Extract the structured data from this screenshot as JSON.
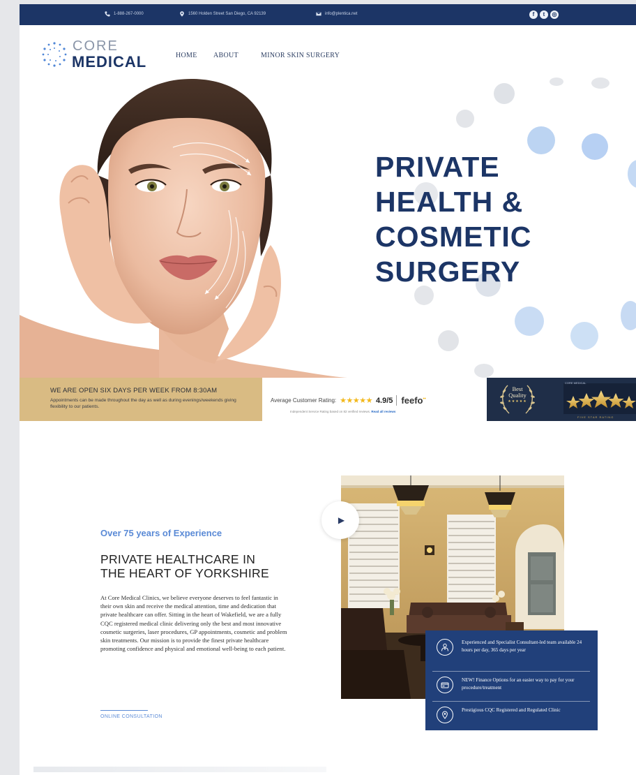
{
  "topbar": {
    "phone": "1-888-267-0000",
    "address": "1560 Holden Street San Diego, CA 92139",
    "email": "info@plentica.net",
    "social_icons": [
      "facebook-icon",
      "twitter-icon",
      "instagram-icon"
    ]
  },
  "brand": {
    "line1": "CORE",
    "line2": "MEDICAL"
  },
  "nav": {
    "home": "HOME",
    "about": "ABOUT",
    "minor": "MINOR SKIN SURGERY"
  },
  "hero": {
    "line1": "PRIVATE",
    "line2": "HEALTH &",
    "line3": "COSMETIC",
    "line4": "SURGERY"
  },
  "open": {
    "title": "WE ARE OPEN SIX DAYS PER WEEK FROM 8:30AM",
    "text": "Appointments can be made throughout the day as well as during evenings/weekends giving flexibility to our patients."
  },
  "rating": {
    "label": "Average Customer Rating:",
    "stars": "★★★★★",
    "score": "4.9/5",
    "brand": "feefo",
    "sub": "Independent Service Rating based on 82 verified reviews.",
    "link": "Read all reviews"
  },
  "badges": {
    "best_line1": "Best",
    "best_line2": "Quality",
    "best_stars": "★★★★★",
    "core": "CORE MEDICAL",
    "caption": "FIVE STAR RATING"
  },
  "about": {
    "kicker": "Over 75 years of Experience",
    "title_line1": "PRIVATE HEALTHCARE IN",
    "title_line2": "THE HEART OF YORKSHIRE",
    "body": "At Core Medical Clinics, we believe everyone deserves to feel fantastic in their own skin and receive the medical attention, time and dedication that private healthcare can offer. Sitting in the heart of Wakefield, we are a fully CQC registered medical clinic delivering only the best and most innovative cosmetic surgeries, laser procedures, GP appointments, cosmetic and problem skin treatments. Our mission is to provide the finest private healthcare promoting confidence and physical and emotional well-being to each patient.",
    "link": "ONLINE CONSULTATION"
  },
  "features": [
    {
      "icon": "doctor-icon",
      "text": "Experienced and Specialist Consultant-led team available 24 hours per day, 365 days per year"
    },
    {
      "icon": "card-icon",
      "text": "NEW! Finance Options for an easier way to pay for your procedure/treatment"
    },
    {
      "icon": "location-pin-icon",
      "text": "Prestigious CQC Registered and Regulated Clinic"
    }
  ],
  "colors": {
    "navy": "#1c3566",
    "accent_blue": "#5a8ad6",
    "gold": "#d9bb83",
    "feature_blue": "#21407a"
  }
}
